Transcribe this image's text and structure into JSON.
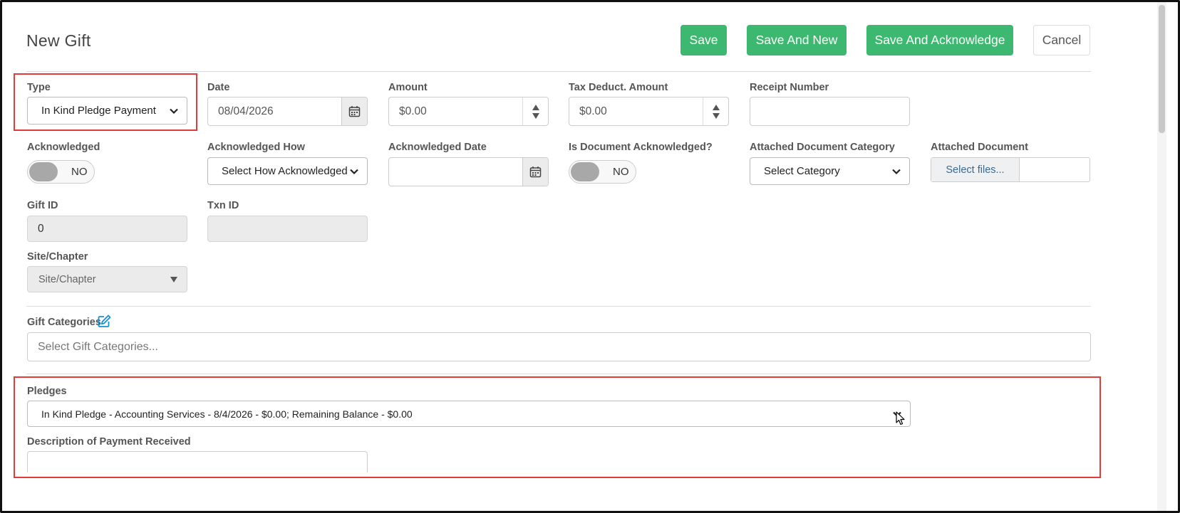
{
  "page": {
    "title": "New Gift"
  },
  "toolbar": {
    "save": "Save",
    "save_new": "Save And New",
    "save_ack": "Save And Acknowledge",
    "cancel": "Cancel"
  },
  "row1": {
    "type": {
      "label": "Type",
      "value": "In Kind Pledge Payment"
    },
    "date": {
      "label": "Date",
      "value": "08/04/2026",
      "icon": "calendar-icon"
    },
    "amount": {
      "label": "Amount",
      "value": "$0.00"
    },
    "tax": {
      "label": "Tax Deduct. Amount",
      "value": "$0.00"
    },
    "receipt": {
      "label": "Receipt Number",
      "value": ""
    }
  },
  "row2": {
    "acknowledged": {
      "label": "Acknowledged",
      "state": "NO"
    },
    "ack_how": {
      "label": "Acknowledged How",
      "value": "Select How Acknowledged"
    },
    "ack_date": {
      "label": "Acknowledged Date",
      "value": "",
      "icon": "calendar-icon"
    },
    "doc_ack": {
      "label": "Is Document Acknowledged?",
      "state": "NO"
    },
    "doc_cat": {
      "label": "Attached Document Category",
      "value": "Select Category"
    },
    "doc": {
      "label": "Attached Document",
      "button": "Select files..."
    }
  },
  "row3": {
    "gift_id": {
      "label": "Gift ID",
      "value": "0"
    },
    "txn_id": {
      "label": "Txn ID",
      "value": ""
    }
  },
  "site": {
    "label": "Site/Chapter",
    "value": "Site/Chapter"
  },
  "gift_categories": {
    "label": "Gift Categories",
    "placeholder": "Select Gift Categories...",
    "icon": "edit-icon"
  },
  "pledges": {
    "label": "Pledges",
    "value": "In Kind Pledge - Accounting Services - 8/4/2026 - $0.00; Remaining Balance - $0.00"
  },
  "description": {
    "label": "Description of Payment Received",
    "value": ""
  },
  "colors": {
    "accent_green": "#3db870",
    "highlight_red": "#e23b3b",
    "link_blue": "#1a8fd1"
  }
}
